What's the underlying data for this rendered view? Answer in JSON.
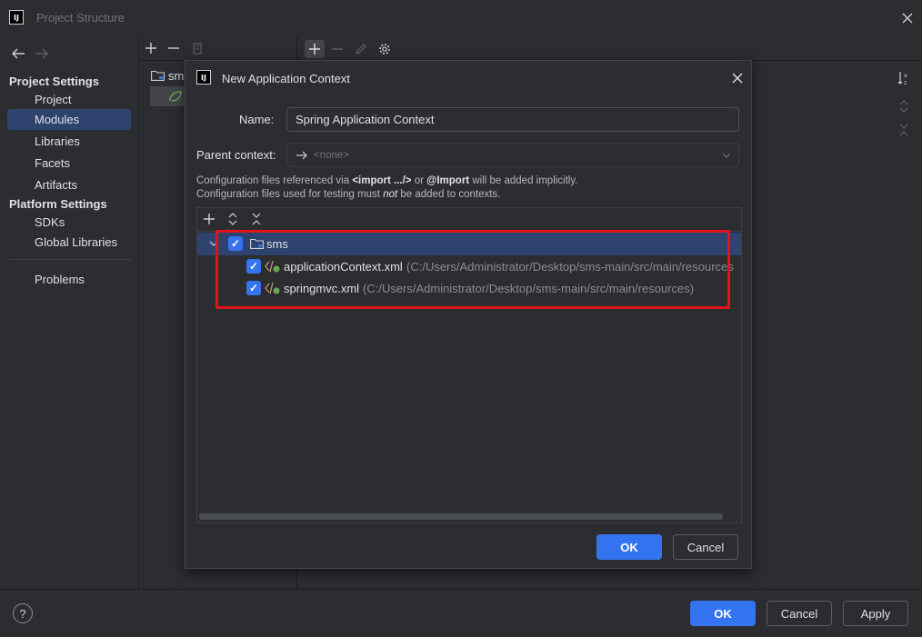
{
  "window": {
    "title": "Project Structure",
    "logo_text": "IJ"
  },
  "sidebar": {
    "project_settings_header": "Project Settings",
    "project_items": [
      "Project",
      "Modules",
      "Libraries",
      "Facets",
      "Artifacts"
    ],
    "selected_item": "Modules",
    "platform_settings_header": "Platform Settings",
    "platform_items": [
      "SDKs",
      "Global Libraries"
    ],
    "problems_label": "Problems"
  },
  "module_tree": {
    "module_label": "sm"
  },
  "dialog": {
    "title": "New Application Context",
    "name_label": "Name:",
    "name_value": "Spring Application Context",
    "parent_label": "Parent context:",
    "parent_value": "<none>",
    "note": {
      "line1_prefix": "Configuration files referenced via ",
      "line1_code1": "<import .../>",
      "line1_mid": " or ",
      "line1_code2": "@Import",
      "line1_suffix": " will be added implicitly.",
      "line2_prefix": "Configuration files used for testing must ",
      "line2_emph": "not",
      "line2_suffix": " be added to contexts."
    },
    "tree": {
      "root": {
        "label": "sms",
        "checked": true
      },
      "files": [
        {
          "name": "applicationContext.xml",
          "path": "(C:/Users/Administrator/Desktop/sms-main/src/main/resources",
          "checked": true
        },
        {
          "name": "springmvc.xml",
          "path": "(C:/Users/Administrator/Desktop/sms-main/src/main/resources)",
          "checked": true
        }
      ]
    },
    "ok_label": "OK",
    "cancel_label": "Cancel"
  },
  "footer": {
    "help_label": "?",
    "ok_label": "OK",
    "cancel_label": "Cancel",
    "apply_label": "Apply"
  },
  "colors": {
    "background": "#2b2d30",
    "accent": "#3574f0",
    "selection": "#2e436e",
    "highlight_border": "#e0151c"
  }
}
